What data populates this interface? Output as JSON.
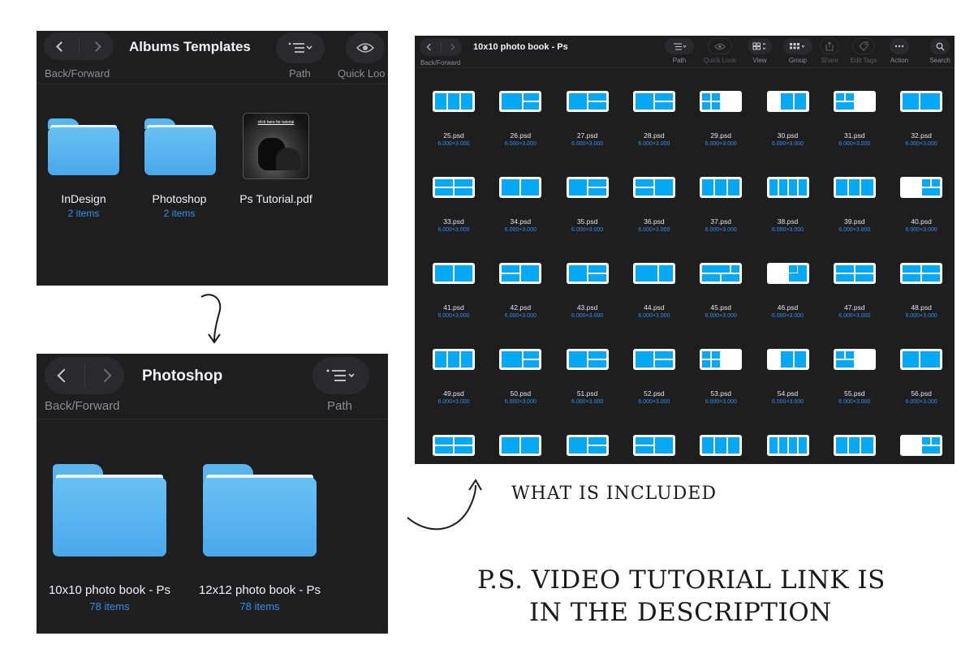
{
  "window_a": {
    "title": "Albums Templates",
    "back_forward_label": "Back/Forward",
    "path_label": "Path",
    "quicklook_label": "Quick Loo",
    "items": [
      {
        "name": "InDesign",
        "count": "2 items",
        "icon": "folder-icon"
      },
      {
        "name": "Photoshop",
        "count": "2 items",
        "icon": "folder-icon"
      },
      {
        "name": "Ps Tutorial.pdf",
        "count": "",
        "icon": "pdf-thumbnail",
        "preview_text": "click here for tutorial"
      }
    ]
  },
  "window_b": {
    "title": "Photoshop",
    "back_forward_label": "Back/Forward",
    "path_label": "Path",
    "items": [
      {
        "name": "10x10 photo book - Ps",
        "count": "78 items",
        "icon": "folder-icon"
      },
      {
        "name": "12x12 photo book - Ps",
        "count": "78 items",
        "icon": "folder-icon"
      }
    ]
  },
  "window_c": {
    "title": "10x10 photo book - Ps",
    "back_forward_label": "Back/Forward",
    "toolbar": [
      {
        "label": "Path",
        "icon": "list-icon"
      },
      {
        "label": "Quick Look",
        "icon": "eye-icon"
      },
      {
        "label": "View",
        "icon": "grid-icon"
      },
      {
        "label": "Group",
        "icon": "group-icon"
      },
      {
        "label": "Share",
        "icon": "share-icon"
      },
      {
        "label": "Edit Tags",
        "icon": "tag-icon"
      },
      {
        "label": "Action",
        "icon": "more-icon"
      },
      {
        "label": "Search",
        "icon": "search-icon"
      }
    ],
    "file_size": "6.000×3.000",
    "files": [
      "25.psd",
      "26.psd",
      "27.psd",
      "28.psd",
      "29.psd",
      "30.psd",
      "31.psd",
      "32.psd",
      "33.psd",
      "34.psd",
      "35.psd",
      "36.psd",
      "37.psd",
      "38.psd",
      "39.psd",
      "40.psd",
      "41.psd",
      "42.psd",
      "43.psd",
      "44.psd",
      "45.psd",
      "46.psd",
      "47.psd",
      "48.psd",
      "49.psd",
      "50.psd",
      "51.psd",
      "52.psd",
      "53.psd",
      "54.psd",
      "55.psd",
      "56.psd",
      "",
      "",
      "",
      "",
      "",
      "",
      "",
      ""
    ]
  },
  "captions": {
    "included": "WHAT IS INCLUDED",
    "ps_line1": "P.S. VIDEO TUTORIAL LINK IS",
    "ps_line2": "IN THE DESCRIPTION"
  },
  "colors": {
    "finder_bg": "#1e1e1f",
    "folder_blue": "#5ab4ee",
    "template_blue": "#03a9f4",
    "count_blue": "#2f8ff0"
  }
}
